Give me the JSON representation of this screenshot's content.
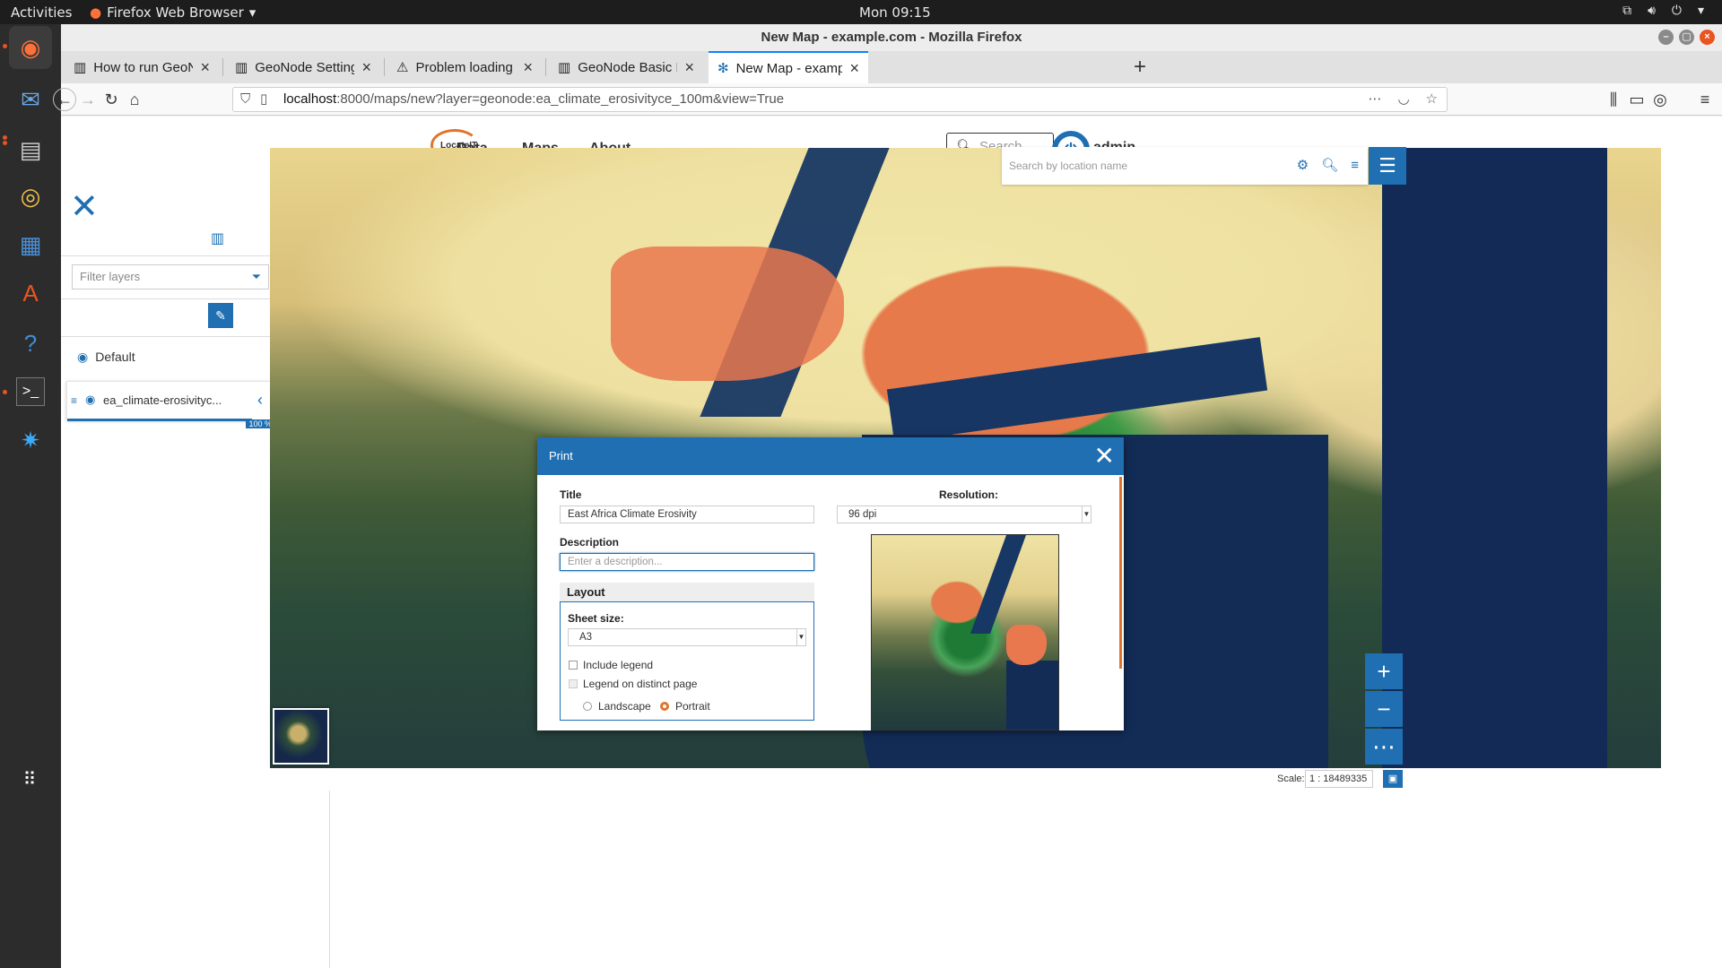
{
  "os": {
    "activities": "Activities",
    "app_name": "Firefox Web Browser",
    "clock": "Mon 09:15"
  },
  "browser": {
    "window_title": "New Map - example.com - Mozilla Firefox",
    "tabs": [
      {
        "label": "How to run GeoNode Co",
        "active": false
      },
      {
        "label": "GeoNode Settings — Ge",
        "active": false
      },
      {
        "label": "Problem loading page",
        "active": false
      },
      {
        "label": "GeoNode Basic Installati",
        "active": false
      },
      {
        "label": "New Map - example.com",
        "active": true
      }
    ],
    "url_host": "localhost",
    "url_rest": ":8000/maps/new?layer=geonode:ea_climate_erosivityce_100m&view=True"
  },
  "geonode": {
    "logo_text": "LocateIT",
    "menu": [
      "Data",
      "Maps",
      "About"
    ],
    "search_placeholder": "Search",
    "user": "admin"
  },
  "toc": {
    "filter_placeholder": "Filter layers",
    "group_name": "Default",
    "layer_name": "ea_climate-erosivityc...",
    "layer_opacity": "100 %"
  },
  "map": {
    "search_placeholder": "Search by location name",
    "scale_label": "Scale:",
    "scale_value": "1 : 18489335"
  },
  "print": {
    "title": "Print",
    "title_label": "Title",
    "title_value": "East Africa Climate Erosivity",
    "resolution_label": "Resolution:",
    "resolution_value": "96 dpi",
    "description_label": "Description",
    "description_placeholder": "Enter a description...",
    "layout_label": "Layout",
    "sheet_size_label": "Sheet size:",
    "sheet_size_value": "A3",
    "include_legend": "Include legend",
    "legend_distinct": "Legend on distinct page",
    "landscape": "Landscape",
    "portrait": "Portrait",
    "orientation_selected": "Portrait"
  },
  "colors": {
    "accent": "#1f6fb2",
    "brand_orange": "#e0742b"
  }
}
